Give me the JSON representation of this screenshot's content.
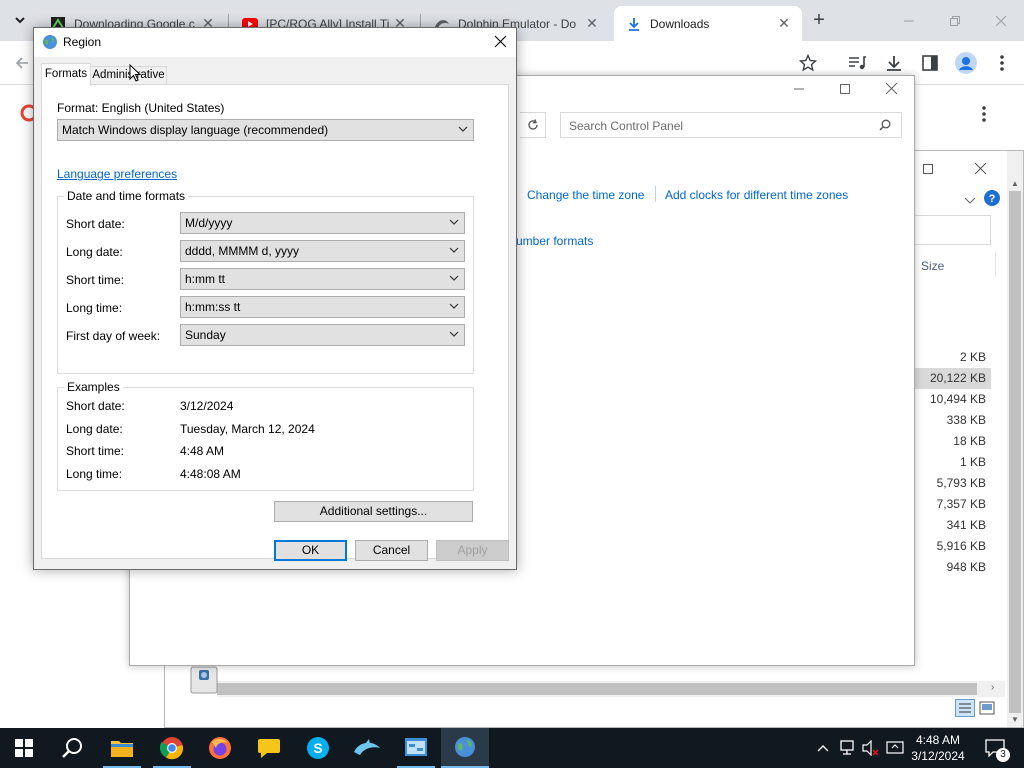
{
  "browser": {
    "tabs": [
      {
        "title": "Downloading Google.c",
        "icon": "google-download-favicon",
        "active": false
      },
      {
        "title": "[PC/ROG Ally] Install Ti",
        "icon": "youtube-favicon",
        "active": false
      },
      {
        "title": "Dolphin Emulator - Do",
        "icon": "dolphin-favicon",
        "active": false
      },
      {
        "title": "Downloads",
        "icon": "download-icon",
        "active": true
      }
    ],
    "new_tab_symbol": "+",
    "tab_close_symbol": "✕"
  },
  "control_panel": {
    "search_placeholder": "Search Control Panel",
    "links": {
      "change_time_zone": "Change the time zone",
      "add_clocks": "Add clocks for different time zones",
      "number_formats_partial": "umber formats"
    }
  },
  "explorer": {
    "size_header": "Size",
    "sizes": [
      "2 KB",
      "20,122 KB",
      "10,494 KB",
      "338 KB",
      "18 KB",
      "1 KB",
      "5,793 KB",
      "7,357 KB",
      "341 KB",
      "5,916 KB",
      "948 KB"
    ]
  },
  "region_dialog": {
    "title": "Region",
    "tabs": {
      "formats": "Formats",
      "administrative": "Administrative"
    },
    "format_label": "Format: English (United States)",
    "format_value": "Match Windows display language (recommended)",
    "language_preferences": "Language preferences",
    "date_time_group": "Date and time formats",
    "fields": [
      {
        "label": "Short date:",
        "value": "M/d/yyyy"
      },
      {
        "label": "Long date:",
        "value": "dddd, MMMM d, yyyy"
      },
      {
        "label": "Short time:",
        "value": "h:mm tt"
      },
      {
        "label": "Long time:",
        "value": "h:mm:ss tt"
      },
      {
        "label": "First day of week:",
        "value": "Sunday"
      }
    ],
    "examples_group": "Examples",
    "examples": [
      {
        "label": "Short date:",
        "value": "3/12/2024"
      },
      {
        "label": "Long date:",
        "value": "Tuesday, March 12, 2024"
      },
      {
        "label": "Short time:",
        "value": "4:48 AM"
      },
      {
        "label": "Long time:",
        "value": "4:48:08 AM"
      }
    ],
    "additional_settings": "Additional settings...",
    "ok": "OK",
    "cancel": "Cancel",
    "apply": "Apply"
  },
  "taskbar": {
    "time": "4:48 AM",
    "date": "3/12/2024",
    "notification_count": "3",
    "apps": [
      "file-explorer-icon",
      "chrome-icon",
      "firefox-icon",
      "chat-icon",
      "skype-icon",
      "dolphin-icon",
      "control-panel-icon",
      "region-icon"
    ]
  },
  "colors": {
    "accent": "#0078d7",
    "link": "#0066cc",
    "taskbar": "#101820"
  }
}
